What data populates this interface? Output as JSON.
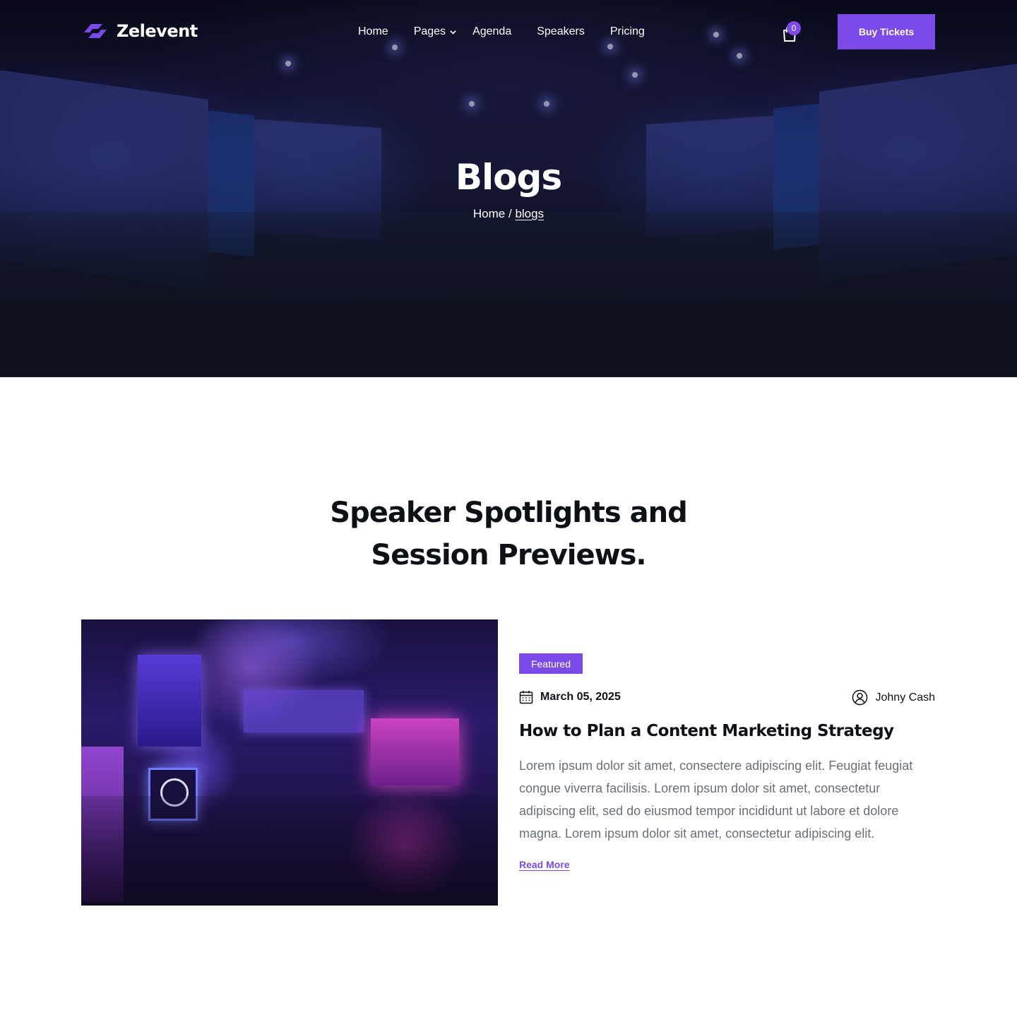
{
  "brand": {
    "name": "Zelevent",
    "accent": "#7b4ae8"
  },
  "nav": {
    "items": [
      {
        "label": "Home"
      },
      {
        "label": "Pages",
        "icon": "chevron-down-icon"
      },
      {
        "label": "Agenda"
      },
      {
        "label": "Speakers"
      },
      {
        "label": "Pricing"
      }
    ],
    "cart_count": "0",
    "cart_icon": "shopping-bag-icon",
    "cta_label": "Buy Tickets"
  },
  "hero": {
    "title": "Blogs",
    "breadcrumb": {
      "home": "Home",
      "separator": "/",
      "current": "blogs"
    }
  },
  "section": {
    "title_line1": "Speaker Spotlights and",
    "title_line2": "Session Previews."
  },
  "post": {
    "badge": "Featured",
    "date": "March 05, 2025",
    "date_icon": "calendar-icon",
    "author": "Johny Cash",
    "author_icon": "user-icon",
    "title": "How to Plan a Content Marketing Strategy",
    "excerpt": "Lorem ipsum dolor sit amet, consectere adipiscing elit. Feugiat feugiat congue viverra facilisis. Lorem ipsum dolor sit amet, consectetur adipiscing elit, sed do eiusmod tempor incididunt ut labore et dolore magna. Lorem ipsum dolor sit amet, consectetur adipiscing elit.",
    "read_more": "Read More"
  }
}
